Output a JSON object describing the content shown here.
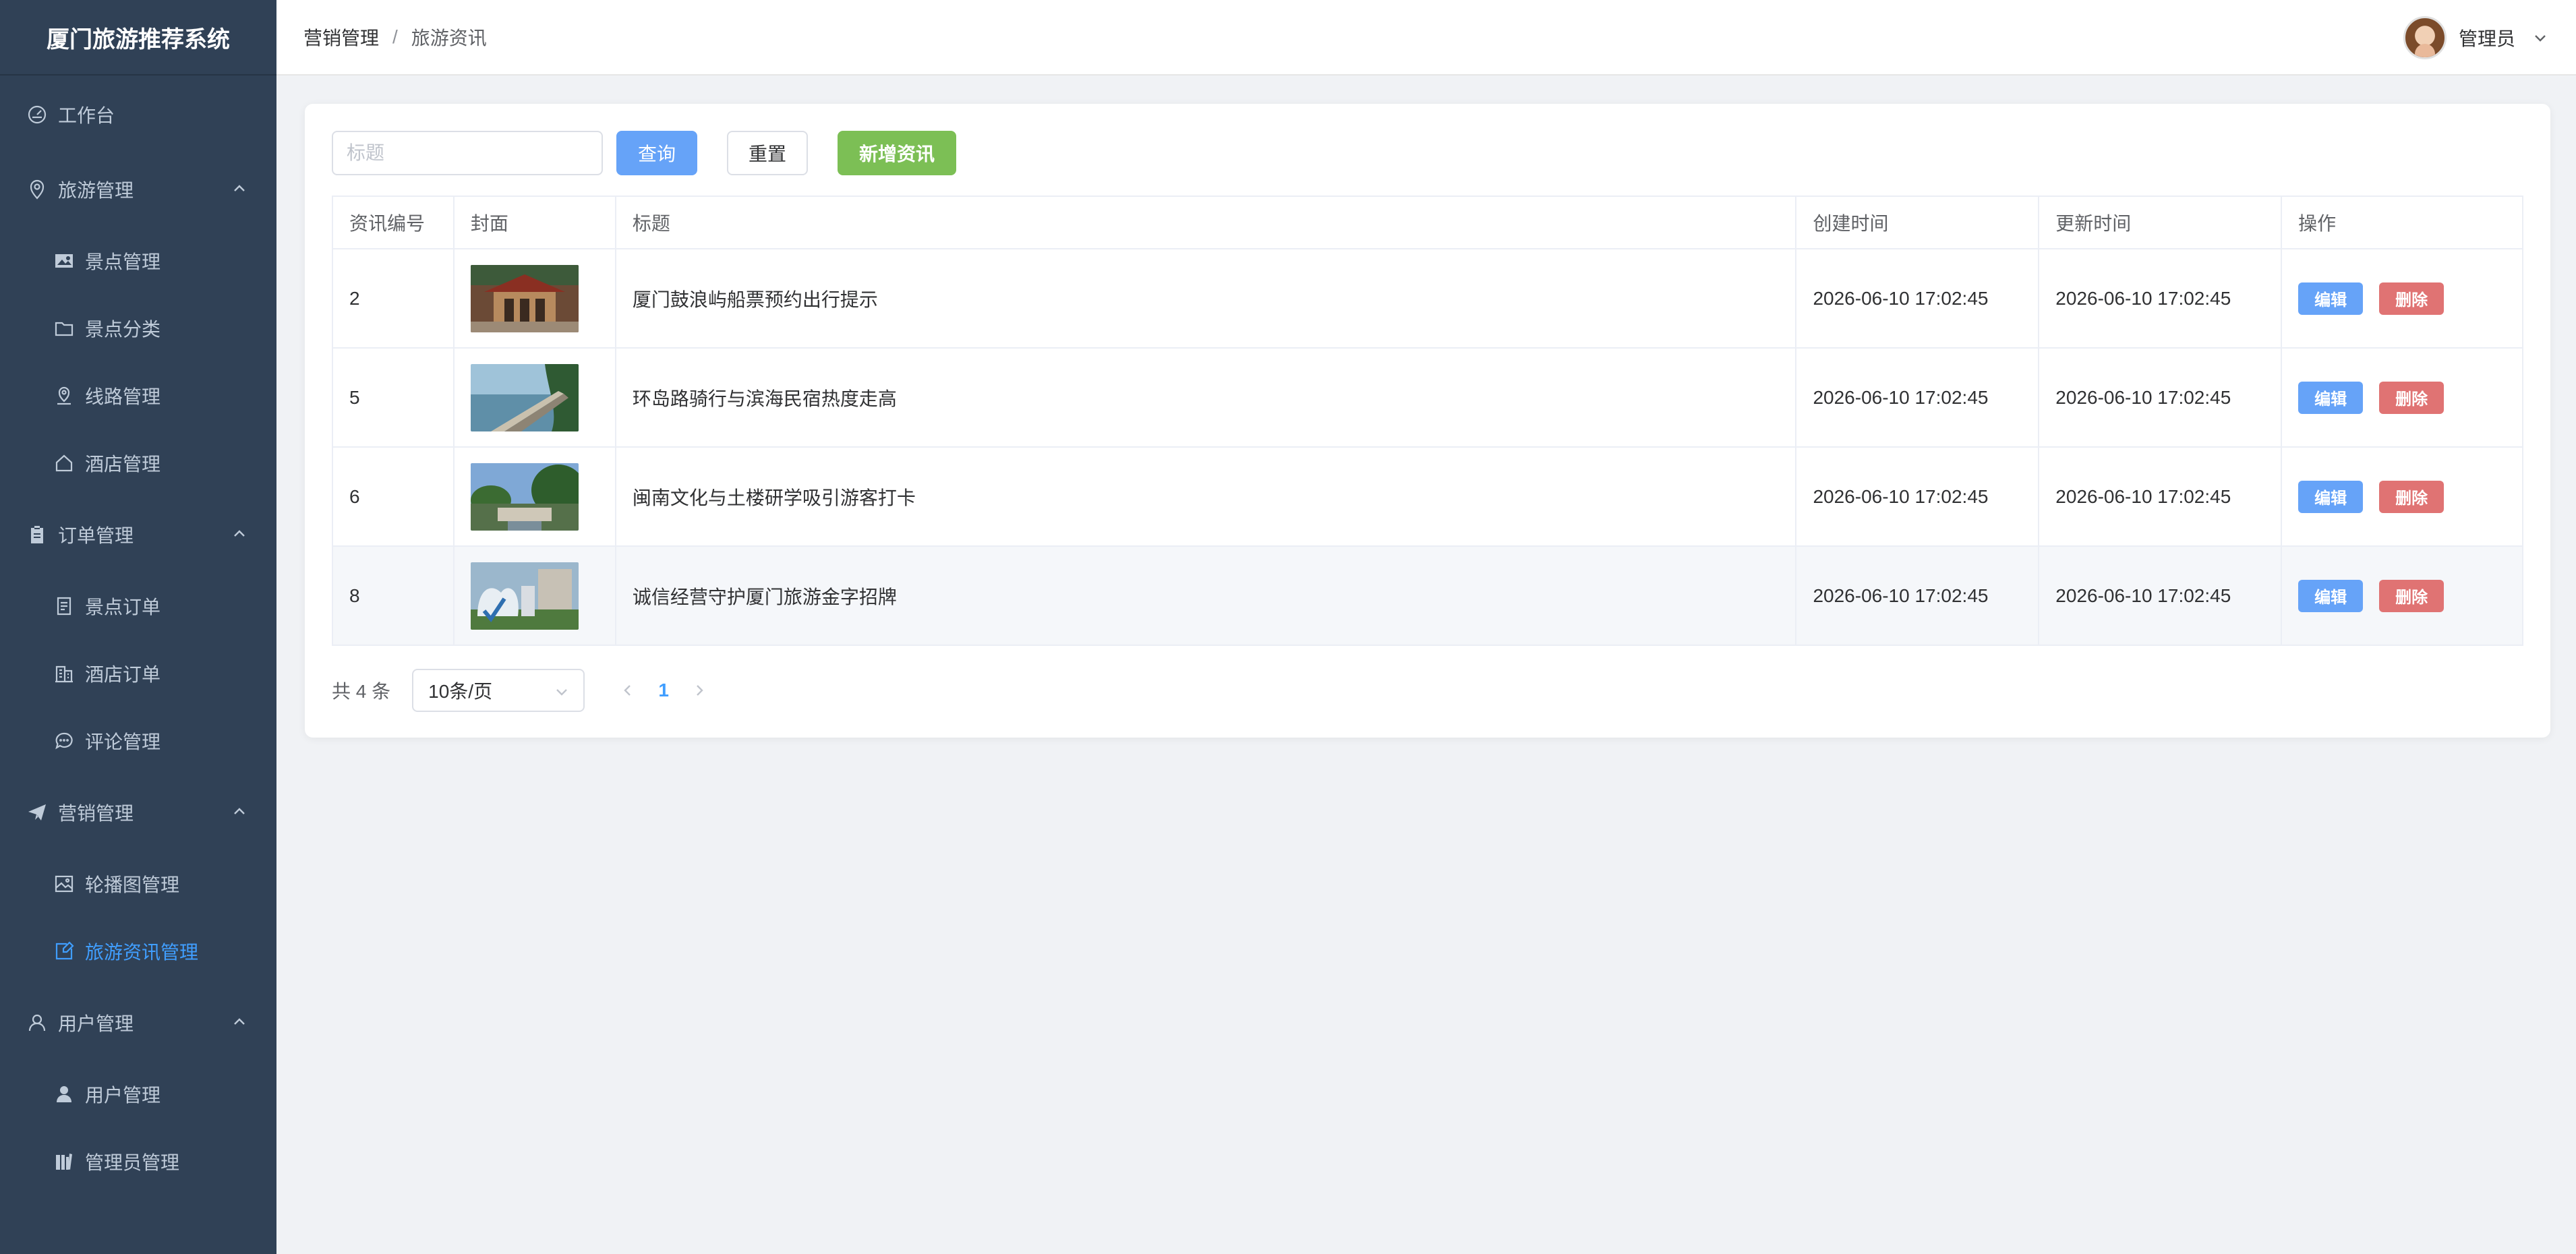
{
  "app": {
    "title": "厦门旅游推荐系统"
  },
  "sidebar": {
    "items": [
      {
        "label": "工作台",
        "icon": "dashboard-icon"
      },
      {
        "label": "旅游管理",
        "icon": "location-icon"
      },
      {
        "label": "景点管理",
        "icon": "picture-icon"
      },
      {
        "label": "景点分类",
        "icon": "folder-icon"
      },
      {
        "label": "线路管理",
        "icon": "route-icon"
      },
      {
        "label": "酒店管理",
        "icon": "house-icon"
      },
      {
        "label": "订单管理",
        "icon": "clipboard-icon"
      },
      {
        "label": "景点订单",
        "icon": "document-icon"
      },
      {
        "label": "酒店订单",
        "icon": "office-building-icon"
      },
      {
        "label": "评论管理",
        "icon": "chat-icon"
      },
      {
        "label": "营销管理",
        "icon": "promotion-icon"
      },
      {
        "label": "轮播图管理",
        "icon": "picture-outline-icon"
      },
      {
        "label": "旅游资讯管理",
        "icon": "news-icon"
      },
      {
        "label": "用户管理",
        "icon": "user-icon"
      },
      {
        "label": "用户管理",
        "icon": "user-solid-icon"
      },
      {
        "label": "管理员管理",
        "icon": "admin-icon"
      }
    ],
    "active_color": "#409eff",
    "background": "#304156"
  },
  "header": {
    "breadcrumb": [
      "营销管理",
      "旅游资讯"
    ],
    "breadcrumb_separator": "/",
    "user_name": "管理员"
  },
  "toolbar": {
    "search_placeholder": "标题",
    "search_value": "",
    "query_label": "查询",
    "reset_label": "重置",
    "add_label": "新增资讯"
  },
  "table": {
    "columns": [
      "资讯编号",
      "封面",
      "标题",
      "创建时间",
      "更新时间",
      "操作"
    ],
    "rows": [
      {
        "id": "2",
        "title": "厦门鼓浪屿船票预约出行提示",
        "created": "2026-06-10 17:02:45",
        "updated": "2026-06-10 17:02:45"
      },
      {
        "id": "5",
        "title": "环岛路骑行与滨海民宿热度走高",
        "created": "2026-06-10 17:02:45",
        "updated": "2026-06-10 17:02:45"
      },
      {
        "id": "6",
        "title": "闽南文化与土楼研学吸引游客打卡",
        "created": "2026-06-10 17:02:45",
        "updated": "2026-06-10 17:02:45"
      },
      {
        "id": "8",
        "title": "诚信经营守护厦门旅游金字招牌",
        "created": "2026-06-10 17:02:45",
        "updated": "2026-06-10 17:02:45"
      }
    ],
    "edit_label": "编辑",
    "delete_label": "删除"
  },
  "pagination": {
    "total_text": "共 4 条",
    "page_size": "10条/页",
    "current_page": "1"
  }
}
